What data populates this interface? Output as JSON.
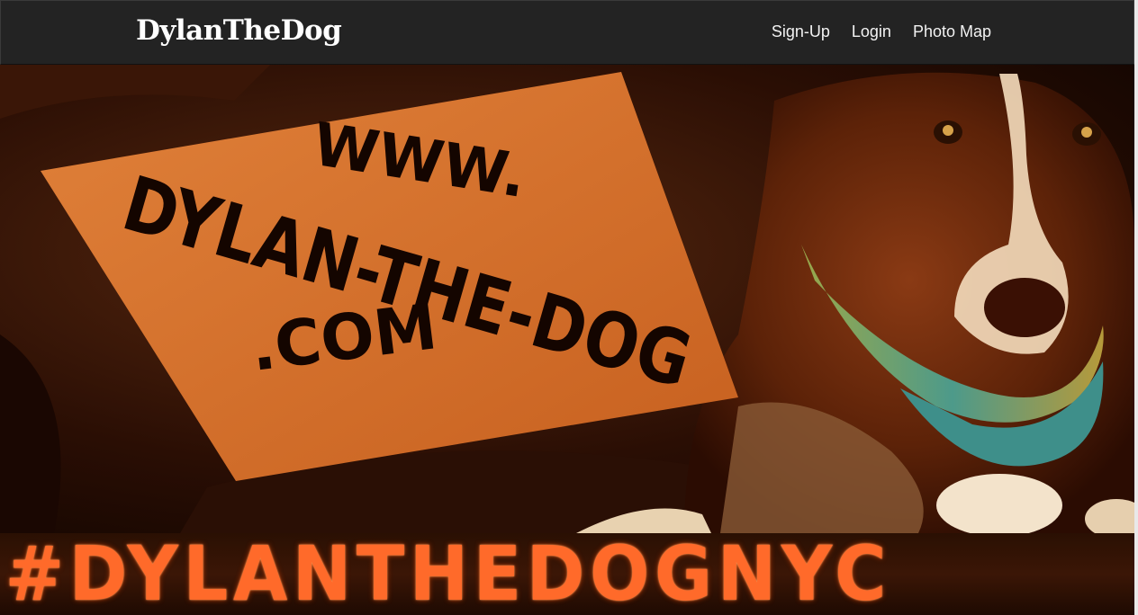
{
  "navbar": {
    "brand": "DylanTheDog",
    "links": [
      "Sign-Up",
      "Login",
      "Photo Map"
    ]
  },
  "hero": {
    "sign_lines": [
      "WWW.",
      "DYLAN-THE-DOG",
      ".COM"
    ]
  },
  "banner": {
    "text": "#DYLANTHEDOGNYC"
  },
  "colors": {
    "navbar_bg": "#232323",
    "sign": "#d9772d",
    "banner_text": "#ff6a2a"
  }
}
